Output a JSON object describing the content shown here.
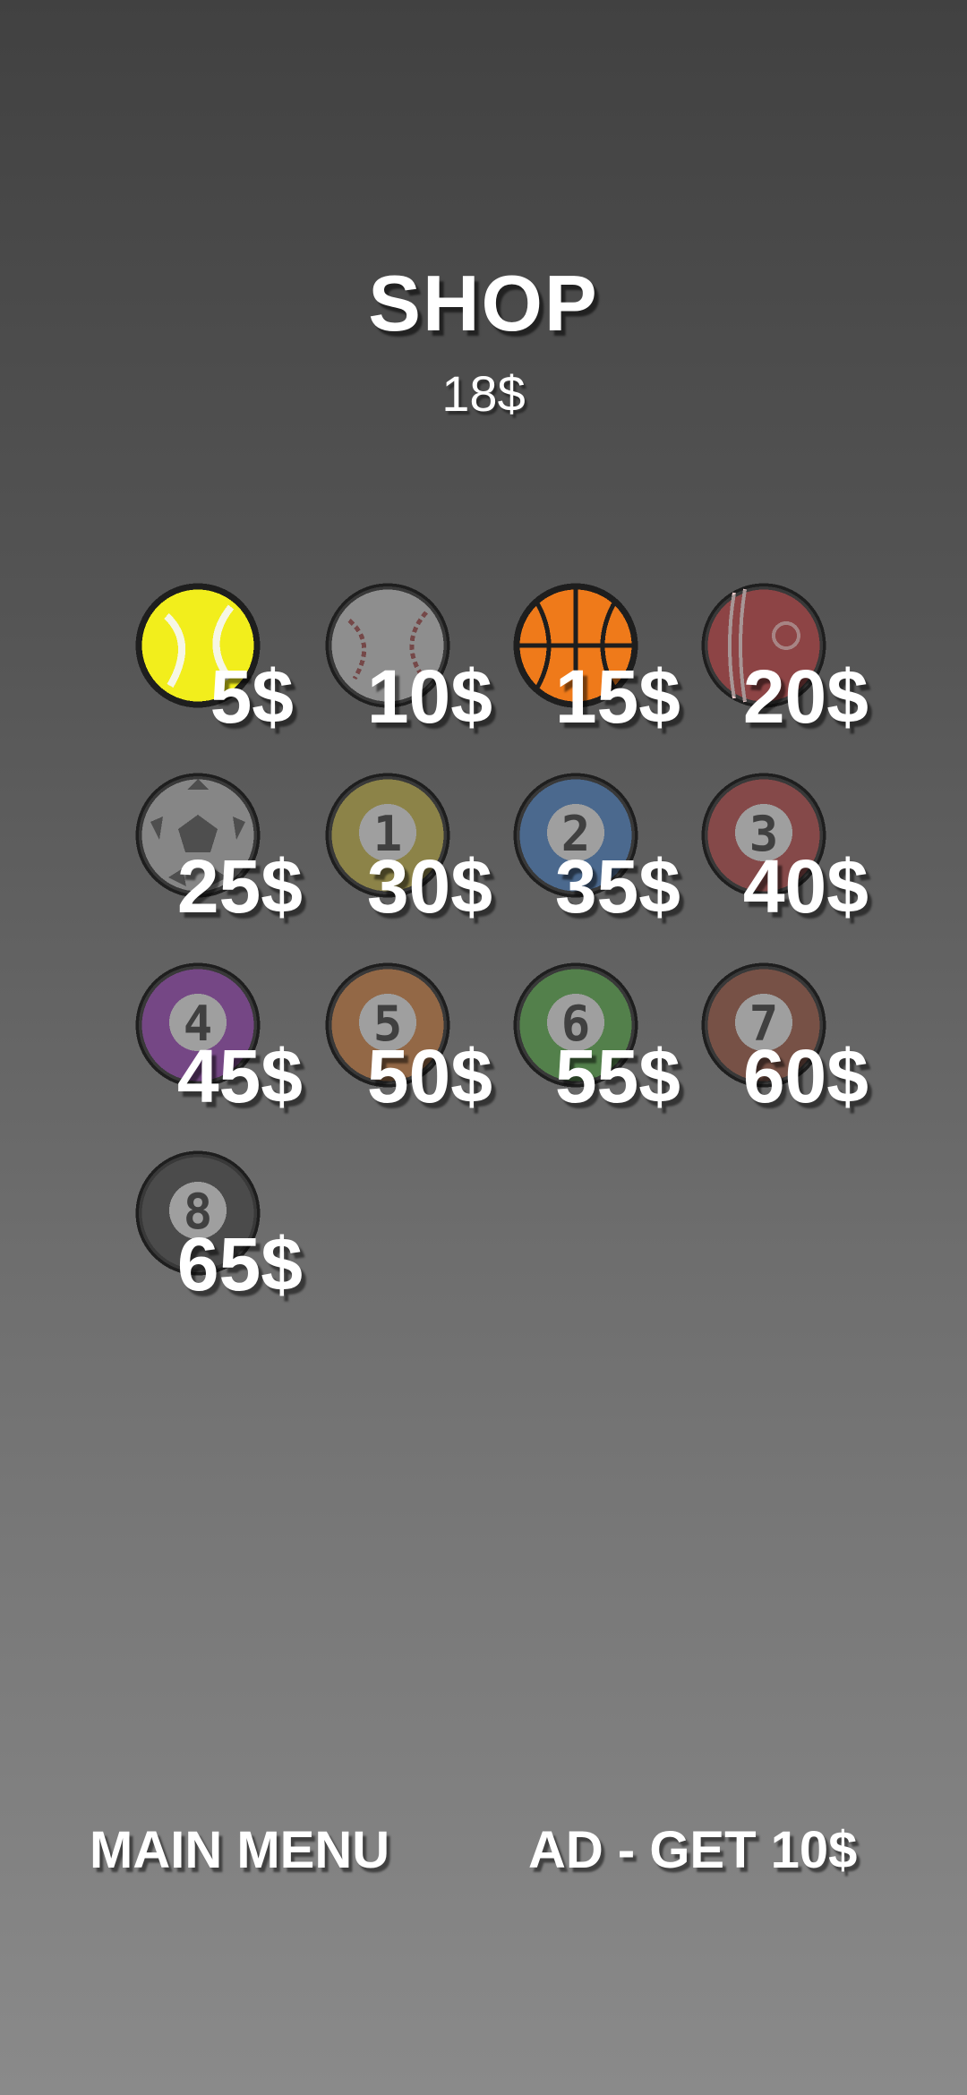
{
  "shop": {
    "title": "SHOP",
    "balance": "18$"
  },
  "items": [
    {
      "name": "tennis-ball",
      "price": "5$",
      "color": "#f2ee1c",
      "number": ""
    },
    {
      "name": "baseball",
      "price": "10$",
      "color": "#b9b9b9",
      "number": ""
    },
    {
      "name": "basketball",
      "price": "15$",
      "color": "#ef7a1a",
      "number": ""
    },
    {
      "name": "cricket-ball",
      "price": "20$",
      "color": "#b73234",
      "number": ""
    },
    {
      "name": "soccer-ball",
      "price": "25$",
      "color": "#a9a9a9",
      "number": ""
    },
    {
      "name": "pool-ball-1",
      "price": "30$",
      "color": "#b5a53a",
      "number": "1"
    },
    {
      "name": "pool-ball-2",
      "price": "35$",
      "color": "#3f75b8",
      "number": "2"
    },
    {
      "name": "pool-ball-3",
      "price": "40$",
      "color": "#a83b3b",
      "number": "3"
    },
    {
      "name": "pool-ball-4",
      "price": "45$",
      "color": "#8a38a8",
      "number": "4"
    },
    {
      "name": "pool-ball-5",
      "price": "50$",
      "color": "#c27435",
      "number": "5"
    },
    {
      "name": "pool-ball-6",
      "price": "55$",
      "color": "#4e9e3f",
      "number": "6"
    },
    {
      "name": "pool-ball-7",
      "price": "60$",
      "color": "#8e4a36",
      "number": "7"
    },
    {
      "name": "pool-ball-8",
      "price": "65$",
      "color": "#3e3e3e",
      "number": "8"
    }
  ],
  "footer": {
    "main_menu_label": "MAIN MENU",
    "ad_label": "AD - GET 10$"
  }
}
